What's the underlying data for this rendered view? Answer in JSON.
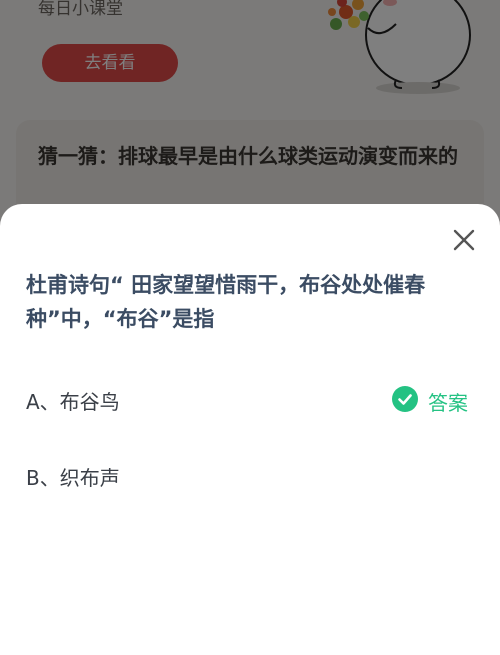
{
  "background": {
    "daily_title": "每日小课堂",
    "watch_button": "去看看",
    "guess_text": "猜一猜：排球最早是由什么球类运动演变而来的"
  },
  "sheet": {
    "question": "杜甫诗句“ 田家望望惜雨干，布谷处处催春种”中，“布谷”是指",
    "options": [
      {
        "label": "A、布谷鸟"
      },
      {
        "label": "B、织布声"
      }
    ],
    "answer_label": "答案"
  },
  "colors": {
    "accent_green": "#24c283",
    "brand_red": "#e04a48",
    "question_text": "#3b4c63"
  },
  "icons": {
    "close": "close-icon",
    "check": "check-circle-icon",
    "mascot": "mascot-illustration"
  }
}
